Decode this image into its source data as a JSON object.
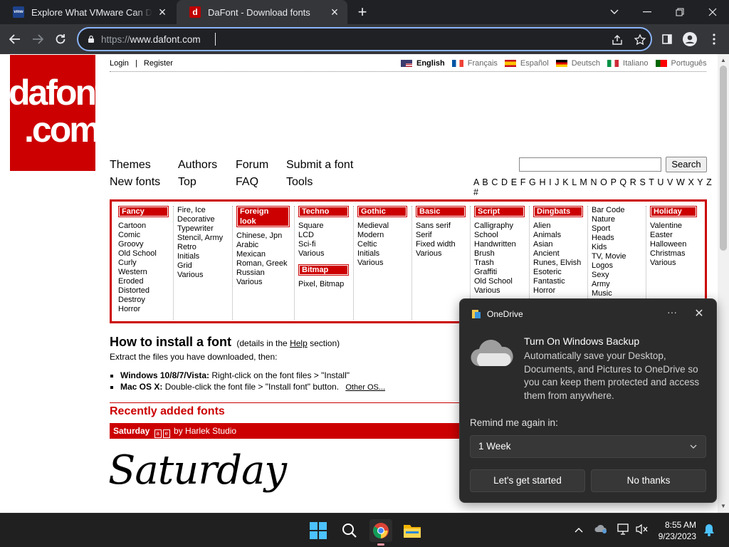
{
  "browser": {
    "tabs": [
      {
        "title": "Explore What VMware Can Do for",
        "favicon_text": "vmw",
        "favicon_color": "#1d428a"
      },
      {
        "title": "DaFont - Download fonts",
        "favicon_text": "d",
        "favicon_color": "#c00000"
      }
    ],
    "url_scheme": "https://",
    "url_host": "www.dafont.com"
  },
  "site": {
    "logo_line1": "dafont",
    "logo_line2": ".com",
    "login": "Login",
    "separator": "|",
    "register": "Register",
    "languages": [
      {
        "label": "English",
        "active": true
      },
      {
        "label": "Français"
      },
      {
        "label": "Español"
      },
      {
        "label": "Deutsch"
      },
      {
        "label": "Italiano"
      },
      {
        "label": "Português"
      }
    ],
    "nav": {
      "themes": "Themes",
      "authors": "Authors",
      "forum": "Forum",
      "submit": "Submit a font",
      "new_fonts": "New fonts",
      "top": "Top",
      "faq": "FAQ",
      "tools": "Tools"
    },
    "search_button": "Search",
    "alphabet": "A B C D E F G H I J K L M N O P Q R S T U V W X Y Z #",
    "categories": [
      {
        "title": "Fancy",
        "items": [
          "Cartoon",
          "Comic",
          "Groovy",
          "Old School",
          "Curly",
          "Western",
          "Eroded",
          "Distorted",
          "Destroy",
          "Horror"
        ]
      },
      {
        "title": "",
        "items": [
          "Fire, Ice",
          "Decorative",
          "Typewriter",
          "Stencil, Army",
          "Retro",
          "Initials",
          "Grid",
          "Various"
        ]
      },
      {
        "title": "Foreign look",
        "items": [
          "Chinese, Jpn",
          "Arabic",
          "Mexican",
          "Roman, Greek",
          "Russian",
          "Various"
        ]
      },
      {
        "title": "Techno",
        "items": [
          "Square",
          "LCD",
          "Sci-fi",
          "Various"
        ],
        "sub_title": "Bitmap",
        "sub_items": [
          "Pixel, Bitmap"
        ]
      },
      {
        "title": "Gothic",
        "items": [
          "Medieval",
          "Modern",
          "Celtic",
          "Initials",
          "Various"
        ]
      },
      {
        "title": "Basic",
        "items": [
          "Sans serif",
          "Serif",
          "Fixed width",
          "Various"
        ]
      },
      {
        "title": "Script",
        "items": [
          "Calligraphy",
          "School",
          "Handwritten",
          "Brush",
          "Trash",
          "Graffiti",
          "Old School",
          "Various"
        ]
      },
      {
        "title": "Dingbats",
        "items": [
          "Alien",
          "Animals",
          "Asian",
          "Ancient",
          "Runes, Elvish",
          "Esoteric",
          "Fantastic",
          "Horror"
        ]
      },
      {
        "title": "",
        "items": [
          "Bar Code",
          "Nature",
          "Sport",
          "Heads",
          "Kids",
          "TV, Movie",
          "Logos",
          "Sexy",
          "Army",
          "Music"
        ]
      },
      {
        "title": "Holiday",
        "items": [
          "Valentine",
          "Easter",
          "Halloween",
          "Christmas",
          "Various"
        ]
      }
    ],
    "howto": {
      "title": "How to install a font",
      "details_pre": "(details in the",
      "details_link": "Help",
      "details_post": "section)",
      "intro": "Extract the files you have downloaded, then:",
      "win_label": "Windows 10/8/7/Vista:",
      "win_text": "Right-click on the font files > \"Install\"",
      "mac_label": "Mac OS X:",
      "mac_text": "Double-click the font file > \"Install font\" button.",
      "other_os": "Other OS..."
    },
    "recent_title": "Recently added fonts",
    "recent_font": {
      "name": "Saturday",
      "by": "by Harlek Studio",
      "preview": "Saturday"
    }
  },
  "toast": {
    "app": "OneDrive",
    "more": "···",
    "title": "Turn On Windows Backup",
    "body": "Automatically save your Desktop, Documents, and Pictures to OneDrive so you can keep them protected and access them from anywhere.",
    "remind_label": "Remind me again in:",
    "remind_value": "1 Week",
    "primary": "Let's get started",
    "secondary": "No thanks"
  },
  "taskbar": {
    "time": "8:55 AM",
    "date": "9/23/2023"
  },
  "colors": {
    "brand_red": "#cc0000",
    "chrome_dark": "#202124",
    "omnibox_focus": "#8ab4f8",
    "toast_bg": "#2b2b2b"
  }
}
